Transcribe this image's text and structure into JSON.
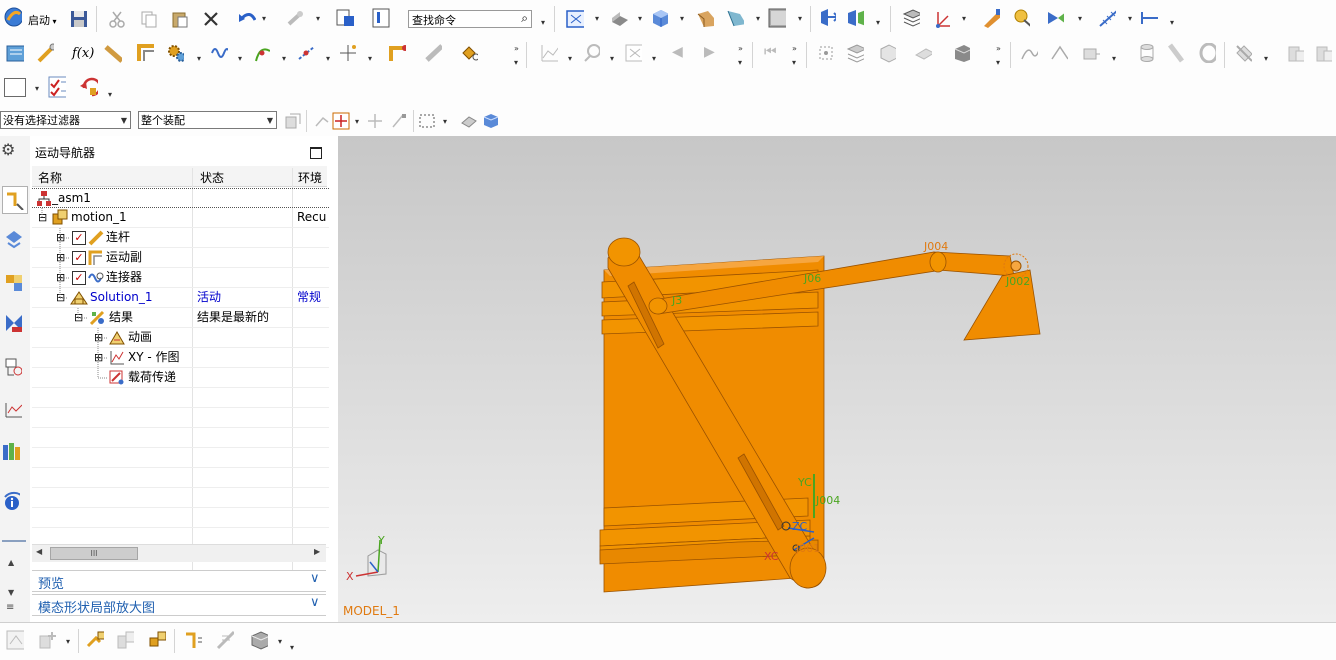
{
  "toolbar1": {
    "start_label": "启动",
    "find_command_value": "查找命令"
  },
  "filters": {
    "selection_filter": "没有选择过滤器",
    "assembly_scope": "整个装配"
  },
  "navigator": {
    "title": "运动导航器",
    "columns": [
      "名称",
      "状态",
      "环境"
    ],
    "rows": [
      {
        "name": "_asm1",
        "status": "",
        "env": ""
      },
      {
        "name": "motion_1",
        "status": "",
        "env": "Recu"
      },
      {
        "name": "连杆",
        "status": "",
        "env": ""
      },
      {
        "name": "运动副",
        "status": "",
        "env": ""
      },
      {
        "name": "连接器",
        "status": "",
        "env": ""
      },
      {
        "name": "Solution_1",
        "status": "活动",
        "env": "常规"
      },
      {
        "name": "结果",
        "status": "结果是最新的",
        "env": ""
      },
      {
        "name": "动画",
        "status": "",
        "env": ""
      },
      {
        "name": "XY - 作图",
        "status": "",
        "env": ""
      },
      {
        "name": "载荷传递",
        "status": "",
        "env": ""
      }
    ],
    "scroll_glyph": "III",
    "preview_label": "预览",
    "zoom_label": "模态形状局部放大图"
  },
  "viewport": {
    "model_label": "MODEL_1",
    "joint_labels": {
      "j004_top": "J004",
      "j006": "J06",
      "j002": "J002",
      "j3": "J3",
      "j004_bottom": "J004",
      "j001": "J001"
    },
    "axis": {
      "x": "X",
      "y": "Y",
      "xc": "XC",
      "yc": "YC",
      "zc": "ZC"
    }
  },
  "colors": {
    "model": "#f08c00",
    "model_dark": "#b05e00",
    "selected": "#0000cc",
    "label": "#e07a10",
    "joint_green": "#4aa520"
  },
  "icons": [
    "search-icon",
    "save-icon",
    "undo-icon",
    "check-icon",
    "gear-icon"
  ]
}
